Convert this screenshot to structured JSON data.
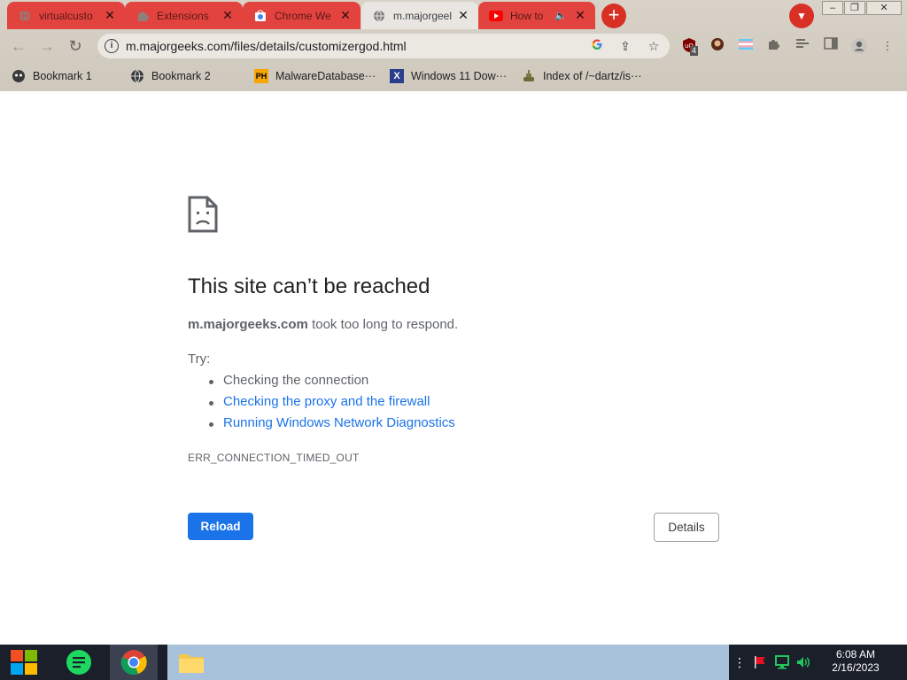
{
  "tabs": [
    {
      "title": "virtualcusto",
      "icon": "globe-icon",
      "active": false
    },
    {
      "title": "Extensions",
      "icon": "puzzle-icon",
      "active": false
    },
    {
      "title": "Chrome We",
      "icon": "chrome-webstore-icon",
      "active": false
    },
    {
      "title": "m.majorgeel",
      "icon": "globe-icon",
      "active": true
    },
    {
      "title": "How to",
      "icon": "youtube-icon",
      "active": false
    }
  ],
  "toolbar": {
    "url": "m.majorgeeks.com/files/details/customizergod.html",
    "extension_badge": "4"
  },
  "bookmarks": [
    {
      "label": "Bookmark 1",
      "icon": "mask-icon"
    },
    {
      "label": "Bookmark 2",
      "icon": "globe-icon"
    },
    {
      "label": "MalwareDatabase···",
      "icon": "ph-icon"
    },
    {
      "label": "Windows 11 Dow···",
      "icon": "x-icon"
    },
    {
      "label": "Index of /~dartz/is···",
      "icon": "tank-icon"
    }
  ],
  "error": {
    "title": "This site can’t be reached",
    "host": "m.majorgeeks.com",
    "desc_rest": " took too long to respond.",
    "try_label": "Try:",
    "suggestions": [
      {
        "text": "Checking the connection",
        "link": false
      },
      {
        "text": "Checking the proxy and the firewall",
        "link": true
      },
      {
        "text": "Running Windows Network Diagnostics",
        "link": true
      }
    ],
    "code": "ERR_CONNECTION_TIMED_OUT",
    "reload_label": "Reload",
    "details_label": "Details"
  },
  "taskbar": {
    "time": "6:08 AM",
    "date": "2/16/2023"
  },
  "colors": {
    "tab_red": "#e2433f",
    "accent_blue": "#1a73e8",
    "taskbar_bg": "#1a1f2a"
  }
}
